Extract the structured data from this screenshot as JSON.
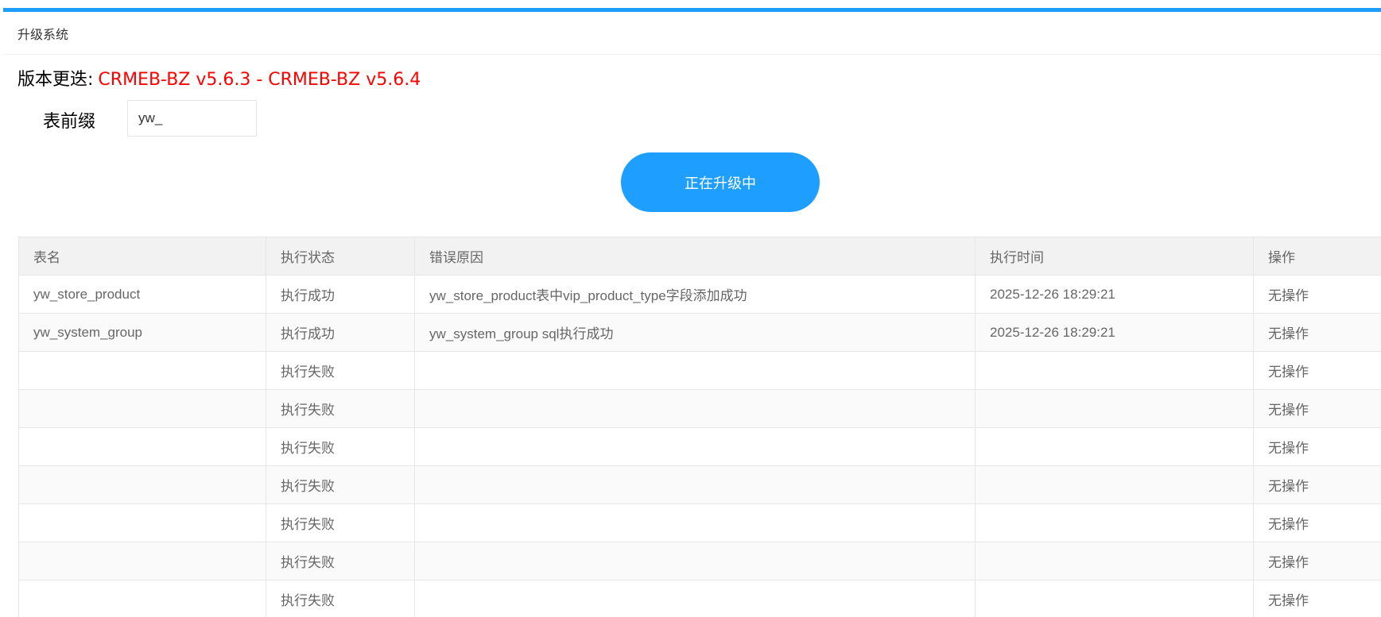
{
  "header": {
    "title": "升级系统"
  },
  "version": {
    "label": "版本更迭:",
    "value": "CRMEB-BZ v5.6.3 - CRMEB-BZ v5.6.4"
  },
  "prefix": {
    "label": "表前缀",
    "value": "yw_"
  },
  "upgrade_button": {
    "label": "正在升级中"
  },
  "table": {
    "columns": [
      "表名",
      "执行状态",
      "错误原因",
      "执行时间",
      "操作"
    ],
    "rows": [
      {
        "name": "yw_store_product",
        "status": "执行成功",
        "reason": "yw_store_product表中vip_product_type字段添加成功",
        "time": "2025-12-26 18:29:21",
        "action": "无操作"
      },
      {
        "name": "yw_system_group",
        "status": "执行成功",
        "reason": "yw_system_group sql执行成功",
        "time": "2025-12-26 18:29:21",
        "action": "无操作"
      },
      {
        "name": "",
        "status": "执行失败",
        "reason": "",
        "time": "",
        "action": "无操作"
      },
      {
        "name": "",
        "status": "执行失败",
        "reason": "",
        "time": "",
        "action": "无操作"
      },
      {
        "name": "",
        "status": "执行失败",
        "reason": "",
        "time": "",
        "action": "无操作"
      },
      {
        "name": "",
        "status": "执行失败",
        "reason": "",
        "time": "",
        "action": "无操作"
      },
      {
        "name": "",
        "status": "执行失败",
        "reason": "",
        "time": "",
        "action": "无操作"
      },
      {
        "name": "",
        "status": "执行失败",
        "reason": "",
        "time": "",
        "action": "无操作"
      },
      {
        "name": "",
        "status": "执行失败",
        "reason": "",
        "time": "",
        "action": "无操作"
      }
    ]
  },
  "colors": {
    "accent": "#1e9fff",
    "version_text": "#ff0000",
    "header_bg": "#f2f2f2",
    "border": "#e6e6e6"
  }
}
